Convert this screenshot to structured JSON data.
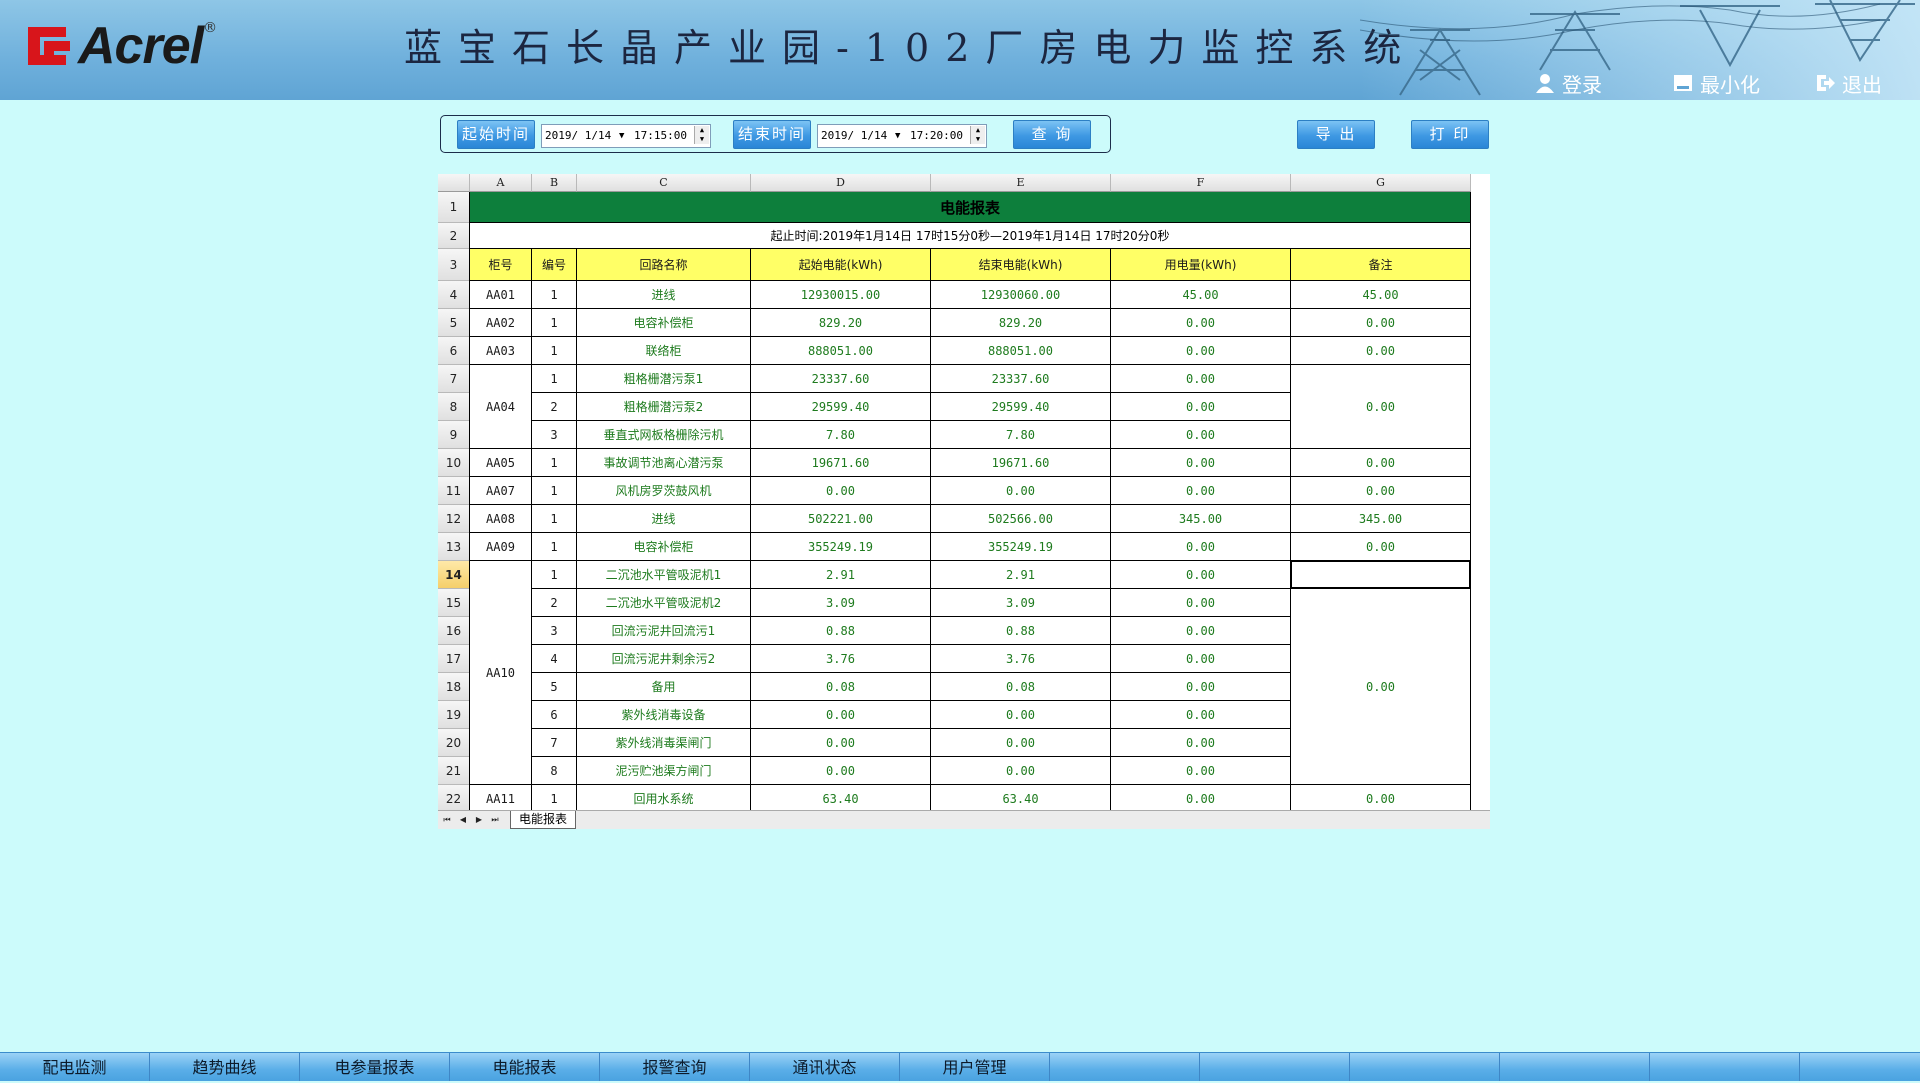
{
  "header": {
    "logo_text": "Acrel",
    "logo_reg": "®",
    "title": "蓝宝石长晶产业园-102厂房电力监控系统",
    "buttons": [
      {
        "label": "登录",
        "icon": "user-icon"
      },
      {
        "label": "最小化",
        "icon": "minimize-icon"
      },
      {
        "label": "退出",
        "icon": "exit-icon"
      }
    ],
    "colors": {
      "bar": "#6fb0dc",
      "title": "#1c2640"
    }
  },
  "query": {
    "start_label": "起始时间",
    "start_date": "2019/ 1/14",
    "start_time": "17:15:00",
    "end_label": "结束时间",
    "end_date": "2019/ 1/14",
    "end_time": "17:20:00",
    "query_label": "查 询",
    "export_label": "导 出",
    "print_label": "打 印"
  },
  "sheet": {
    "col_letters": [
      "A",
      "B",
      "C",
      "D",
      "E",
      "F",
      "G"
    ],
    "row_numbers": [
      "1",
      "2",
      "3",
      "4",
      "5",
      "6",
      "7",
      "8",
      "9",
      "10",
      "11",
      "12",
      "13",
      "14",
      "15",
      "16",
      "17",
      "18",
      "19",
      "20",
      "21",
      "22"
    ],
    "active_row": "14",
    "title": "电能报表",
    "period": "起止时间:2019年1月14日  17时15分0秒—2019年1月14日  17时20分0秒",
    "headers": [
      "柜号",
      "编号",
      "回路名称",
      "起始电能(kWh)",
      "结束电能(kWh)",
      "用电量(kWh)",
      "备注"
    ],
    "rows": [
      {
        "no": "1",
        "name": "进线",
        "start": "12930015.00",
        "end": "12930060.00",
        "use": "45.00"
      },
      {
        "no": "1",
        "name": "电容补偿柜",
        "start": "829.20",
        "end": "829.20",
        "use": "0.00"
      },
      {
        "no": "1",
        "name": "联络柜",
        "start": "888051.00",
        "end": "888051.00",
        "use": "0.00"
      },
      {
        "no": "1",
        "name": "粗格栅潜污泵1",
        "start": "23337.60",
        "end": "23337.60",
        "use": "0.00"
      },
      {
        "no": "2",
        "name": "粗格栅潜污泵2",
        "start": "29599.40",
        "end": "29599.40",
        "use": "0.00"
      },
      {
        "no": "3",
        "name": "垂直式网板格栅除污机",
        "start": "7.80",
        "end": "7.80",
        "use": "0.00"
      },
      {
        "no": "1",
        "name": "事故调节池离心潜污泵",
        "start": "19671.60",
        "end": "19671.60",
        "use": "0.00"
      },
      {
        "no": "1",
        "name": "风机房罗茨鼓风机",
        "start": "0.00",
        "end": "0.00",
        "use": "0.00"
      },
      {
        "no": "1",
        "name": "进线",
        "start": "502221.00",
        "end": "502566.00",
        "use": "345.00"
      },
      {
        "no": "1",
        "name": "电容补偿柜",
        "start": "355249.19",
        "end": "355249.19",
        "use": "0.00"
      },
      {
        "no": "1",
        "name": "二沉池水平管吸泥机1",
        "start": "2.91",
        "end": "2.91",
        "use": "0.00"
      },
      {
        "no": "2",
        "name": "二沉池水平管吸泥机2",
        "start": "3.09",
        "end": "3.09",
        "use": "0.00"
      },
      {
        "no": "3",
        "name": "回流污泥井回流污1",
        "start": "0.88",
        "end": "0.88",
        "use": "0.00"
      },
      {
        "no": "4",
        "name": "回流污泥井剩余污2",
        "start": "3.76",
        "end": "3.76",
        "use": "0.00"
      },
      {
        "no": "5",
        "name": "备用",
        "start": "0.08",
        "end": "0.08",
        "use": "0.00"
      },
      {
        "no": "6",
        "name": "紫外线消毒设备",
        "start": "0.00",
        "end": "0.00",
        "use": "0.00"
      },
      {
        "no": "7",
        "name": "紫外线消毒渠闸门",
        "start": "0.00",
        "end": "0.00",
        "use": "0.00"
      },
      {
        "no": "8",
        "name": "泥污贮池渠方闸门",
        "start": "0.00",
        "end": "0.00",
        "use": "0.00"
      },
      {
        "no": "1",
        "name": "回用水系统",
        "start": "63.40",
        "end": "63.40",
        "use": "0.00"
      }
    ],
    "cabinets": [
      {
        "label": "AA01",
        "start": 0,
        "span": 1
      },
      {
        "label": "AA02",
        "start": 1,
        "span": 1
      },
      {
        "label": "AA03",
        "start": 2,
        "span": 1
      },
      {
        "label": "AA04",
        "start": 3,
        "span": 3
      },
      {
        "label": "AA05",
        "start": 6,
        "span": 1
      },
      {
        "label": "AA07",
        "start": 7,
        "span": 1
      },
      {
        "label": "AA08",
        "start": 8,
        "span": 1
      },
      {
        "label": "AA09",
        "start": 9,
        "span": 1
      },
      {
        "label": "AA10",
        "start": 10,
        "span": 8
      },
      {
        "label": "AA11",
        "start": 18,
        "span": 1
      }
    ],
    "remarks": [
      {
        "value": "45.00",
        "start": 0,
        "span": 1
      },
      {
        "value": "0.00",
        "start": 1,
        "span": 1
      },
      {
        "value": "0.00",
        "start": 2,
        "span": 1
      },
      {
        "value": "0.00",
        "start": 3,
        "span": 3
      },
      {
        "value": "0.00",
        "start": 6,
        "span": 1
      },
      {
        "value": "0.00",
        "start": 7,
        "span": 1
      },
      {
        "value": "345.00",
        "start": 8,
        "span": 1
      },
      {
        "value": "0.00",
        "start": 9,
        "span": 1
      },
      {
        "value": "",
        "start": 10,
        "span": 1
      },
      {
        "value": "0.00",
        "start": 11,
        "span": 7
      },
      {
        "value": "0.00",
        "start": 18,
        "span": 1
      }
    ],
    "tab_label": "电能报表",
    "colors": {
      "title_bg": "#0d7f3c",
      "header_bg": "#ffff66",
      "value_text": "#1e7b1e"
    }
  },
  "nav": {
    "items": [
      "配电监测",
      "趋势曲线",
      "电参量报表",
      "电能报表",
      "报警查询",
      "通讯状态",
      "用户管理",
      "",
      "",
      "",
      "",
      "",
      ""
    ]
  }
}
